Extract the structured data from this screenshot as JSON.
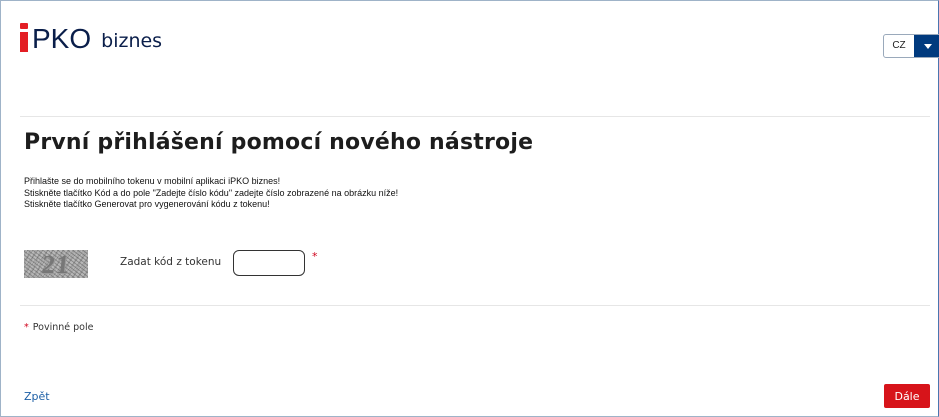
{
  "header": {
    "logo_main": "PKO",
    "logo_sub": "biznes",
    "language": "CZ"
  },
  "page": {
    "title": "První přihlášení pomocí nového nástroje",
    "instructions": [
      "Přihlašte se do mobilního tokenu v mobilní aplikaci iPKO biznes!",
      "Stiskněte tlačítko Kód a do pole \"Zadejte číslo kódu\" zadejte číslo zobrazené na obrázku níže!",
      "Stiskněte tlačítko Generovat pro vygenerování kódu z tokenu!"
    ],
    "captcha_code": "21",
    "token_field_label": "Zadat kód z tokenu",
    "token_field_value": "",
    "required_marker": "*",
    "required_note": "Povinné pole"
  },
  "footer": {
    "back_label": "Zpět",
    "next_label": "Dále"
  },
  "colors": {
    "brand_red": "#d7141a",
    "brand_navy": "#003a7e",
    "link_blue": "#1d5fa6"
  }
}
